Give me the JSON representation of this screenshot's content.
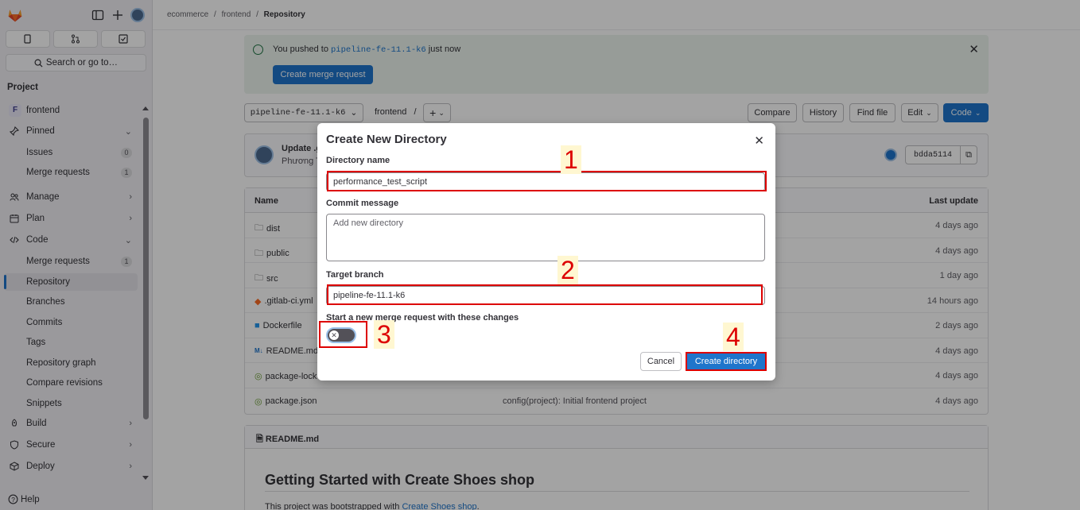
{
  "breadcrumb": {
    "group": "ecommerce",
    "project": "frontend",
    "current": "Repository"
  },
  "sidebar": {
    "section_title": "Project",
    "project_initial": "F",
    "project_name": "frontend",
    "search_placeholder": "Search or go to…",
    "pinned": "Pinned",
    "issues": {
      "label": "Issues",
      "count": "0"
    },
    "merge_requests": {
      "label": "Merge requests",
      "count": "1"
    },
    "manage": "Manage",
    "plan": "Plan",
    "code": "Code",
    "code_items": {
      "merge_requests": {
        "label": "Merge requests",
        "count": "1"
      },
      "repository": "Repository",
      "branches": "Branches",
      "commits": "Commits",
      "tags": "Tags",
      "graph": "Repository graph",
      "compare": "Compare revisions",
      "snippets": "Snippets"
    },
    "build": "Build",
    "secure": "Secure",
    "deploy": "Deploy",
    "help": "Help"
  },
  "alert": {
    "prefix": "You pushed to",
    "branch": "pipeline-fe-11.1-k6",
    "suffix": "just now",
    "button": "Create merge request"
  },
  "repo_bar": {
    "branch": "pipeline-fe-11.1-k6",
    "path": "frontend",
    "separator": "/",
    "compare": "Compare",
    "history": "History",
    "find_file": "Find file",
    "edit": "Edit",
    "code": "Code"
  },
  "commit": {
    "title": "Update .g",
    "author": "Phương T",
    "sha": "bdda5114"
  },
  "table": {
    "headers": {
      "name": "Name",
      "last_update": "Last update"
    },
    "rows": [
      {
        "name": "dist",
        "commit": "",
        "date": "4 days ago"
      },
      {
        "name": "public",
        "commit": "",
        "date": "4 days ago"
      },
      {
        "name": "src",
        "commit": "",
        "date": "1 day ago"
      },
      {
        "name": ".gitlab-ci.yml",
        "commit": "",
        "date": "14 hours ago"
      },
      {
        "name": "Dockerfile",
        "commit": "",
        "date": "2 days ago"
      },
      {
        "name": "README.md",
        "commit": "",
        "date": "4 days ago"
      },
      {
        "name": "package-lock",
        "commit": "",
        "date": "4 days ago"
      },
      {
        "name": "package.json",
        "commit": "config(project): Initial frontend project",
        "date": "4 days ago"
      }
    ]
  },
  "readme": {
    "filename": "README.md",
    "heading": "Getting Started with Create Shoes shop",
    "text_prefix": "This project was bootstrapped with",
    "link": "Create Shoes shop",
    "text_suffix": "."
  },
  "modal": {
    "title": "Create New Directory",
    "dir_label": "Directory name",
    "dir_value": "performance_test_script",
    "commit_label": "Commit message",
    "commit_value": "Add new directory",
    "branch_label": "Target branch",
    "branch_value": "pipeline-fe-11.1-k6",
    "mr_label": "Start a new merge request with these changes",
    "cancel": "Cancel",
    "create": "Create directory"
  },
  "annotations": [
    "1",
    "2",
    "3",
    "4"
  ],
  "colors": {
    "primary": "#1f75cb",
    "annotation": "#dd0000",
    "annotation_bg": "#fff7d1",
    "alert_bg": "#ecf4ee"
  }
}
